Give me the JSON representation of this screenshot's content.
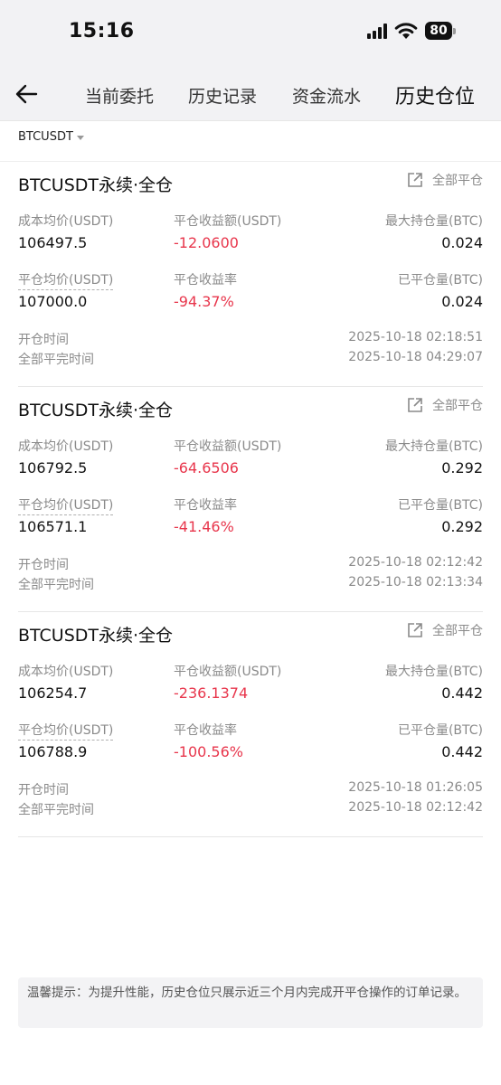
{
  "status_bar": {
    "time": "15:16",
    "battery": "80"
  },
  "nav": {
    "tabs": [
      {
        "label": "当前委托"
      },
      {
        "label": "历史记录"
      },
      {
        "label": "资金流水"
      },
      {
        "label": "历史仓位"
      }
    ]
  },
  "filter": {
    "symbol": "BTCUSDT"
  },
  "labels": {
    "avg_cost": "成本均价(USDT)",
    "close_pnl": "平仓收益额(USDT)",
    "max_hold": "最大持仓量(BTC)",
    "avg_close": "平仓均价(USDT)",
    "close_rate": "平仓收益率",
    "closed_qty": "已平仓量(BTC)",
    "open_time": "开仓时间",
    "full_close_time": "全部平完时间",
    "close_all": "全部平仓"
  },
  "positions": [
    {
      "title": "BTCUSDT永续·全仓",
      "avg_cost": "106497.5",
      "close_pnl": "-12.0600",
      "max_hold": "0.024",
      "avg_close": "107000.0",
      "close_rate": "-94.37%",
      "closed_qty": "0.024",
      "open_time": "2025-10-18 02:18:51",
      "full_close_time": "2025-10-18 04:29:07"
    },
    {
      "title": "BTCUSDT永续·全仓",
      "avg_cost": "106792.5",
      "close_pnl": "-64.6506",
      "max_hold": "0.292",
      "avg_close": "106571.1",
      "close_rate": "-41.46%",
      "closed_qty": "0.292",
      "open_time": "2025-10-18 02:12:42",
      "full_close_time": "2025-10-18 02:13:34"
    },
    {
      "title": "BTCUSDT永续·全仓",
      "avg_cost": "106254.7",
      "close_pnl": "-236.1374",
      "max_hold": "0.442",
      "avg_close": "106788.9",
      "close_rate": "-100.56%",
      "closed_qty": "0.442",
      "open_time": "2025-10-18 01:26:05",
      "full_close_time": "2025-10-18 02:12:42"
    }
  ],
  "notice": "温馨提示：为提升性能，历史仓位只展示近三个月内完成开平仓操作的订单记录。",
  "colors": {
    "negative": "#e8364c",
    "label": "#8a8a8a",
    "header_bg": "#f2f2f4"
  }
}
